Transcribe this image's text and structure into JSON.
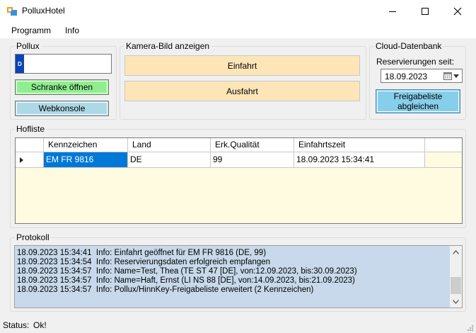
{
  "window": {
    "title": "PolluxHotel"
  },
  "menu": {
    "items": [
      "Programm",
      "Info"
    ]
  },
  "pollux": {
    "group_label": "Pollux",
    "indicator": "D",
    "input_value": "",
    "open_barrier_label": "Schranke öffnen",
    "webconsole_label": "Webkonsole"
  },
  "camera": {
    "group_label": "Kamera-Bild anzeigen",
    "entry_label": "Einfahrt",
    "exit_label": "Ausfahrt"
  },
  "cloud": {
    "group_label": "Cloud-Datenbank",
    "reservations_label": "Reservierungen seit:",
    "date_value": "18.09.2023",
    "sync_label": "Freigabeliste abgleichen"
  },
  "hofliste": {
    "group_label": "Hofliste",
    "columns": [
      "Kennzeichen",
      "Land",
      "Erk.Qualität",
      "Einfahrtszeit"
    ],
    "rows": [
      {
        "Kennzeichen": "EM FR 9816",
        "Land": "DE",
        "Qualitaet": "99",
        "Einfahrtszeit": "18.09.2023 15:34:41"
      }
    ]
  },
  "protokoll": {
    "group_label": "Protokoll",
    "lines": [
      "18.09.2023 15:34:41  Info: Einfahrt geöffnet für EM FR 9816 (DE, 99)",
      "18.09.2023 15:34:54  Info: Reservierungsdaten erfolgreich empfangen",
      "18.09.2023 15:34:57  Info: Name=Test, Thea (TE ST 47 [DE], von:12.09.2023, bis:30.09.2023)",
      "18.09.2023 15:34:57  Info: Name=Haft, Ernst (LI NS 88 [DE], von:14.09.2023, bis:21.09.2023)",
      "18.09.2023 15:34:57  Info: Pollux/HinnKey-Freigabeliste erweitert (2 Kennzeichen)"
    ]
  },
  "status": {
    "label": "Status:",
    "value": "Ok!"
  },
  "colors": {
    "orange_button": "#fde5b7",
    "green_button": "#90ee90",
    "lightblue_button": "#add8e6",
    "sync_button": "#87ceeb",
    "grid_background": "#fffbe1",
    "selection": "#0078d7",
    "log_background": "#c7d9ea"
  }
}
